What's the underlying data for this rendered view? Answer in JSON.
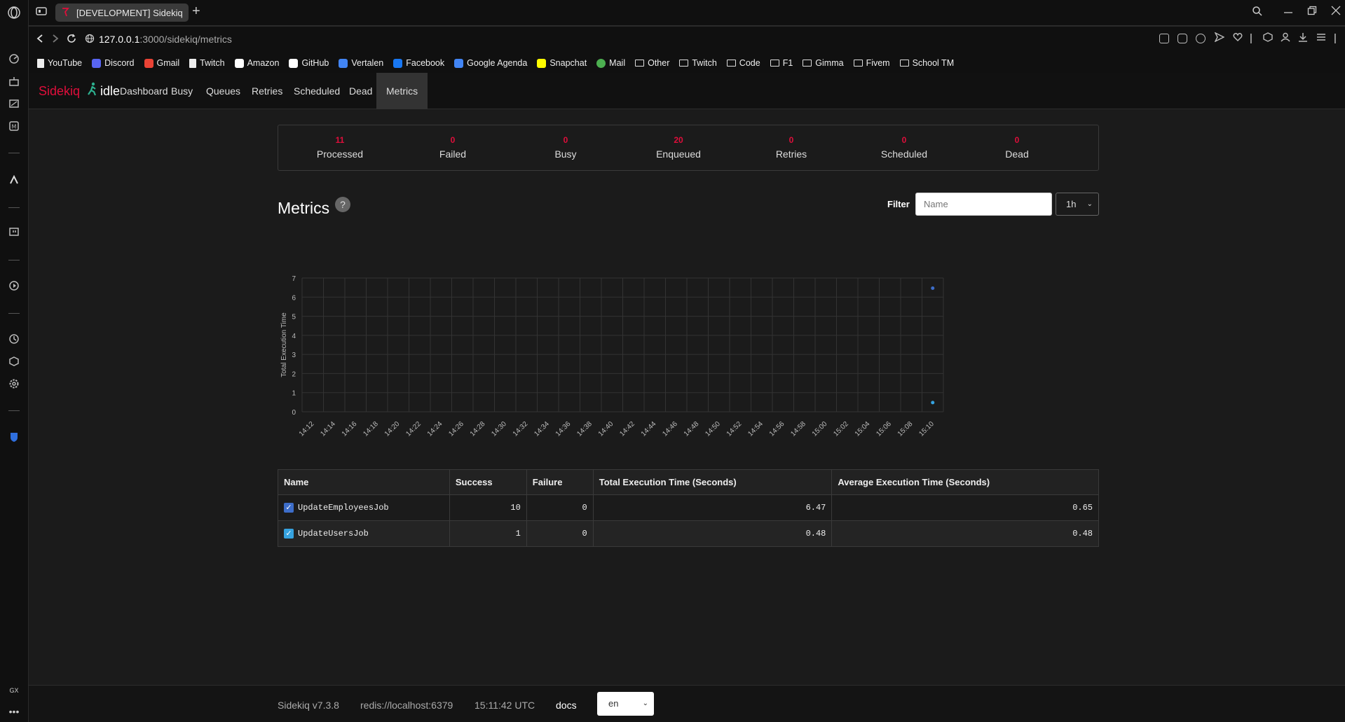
{
  "browser": {
    "tab_title": "[DEVELOPMENT] Sidekiq",
    "url_host": "127.0.0.1",
    "url_path": ":3000/sidekiq/metrics",
    "bookmarks": [
      {
        "label": "YouTube",
        "icon": "page-icon"
      },
      {
        "label": "Discord",
        "icon": "discord-icon",
        "color": "#5865f2"
      },
      {
        "label": "Gmail",
        "icon": "gmail-icon",
        "color": "#ea4335"
      },
      {
        "label": "Twitch",
        "icon": "page-icon"
      },
      {
        "label": "Amazon",
        "icon": "amazon-icon",
        "color": "#ffffff"
      },
      {
        "label": "GitHub",
        "icon": "github-icon",
        "color": "#ffffff"
      },
      {
        "label": "Vertalen",
        "icon": "translate-icon",
        "color": "#4285f4"
      },
      {
        "label": "Facebook",
        "icon": "facebook-icon",
        "color": "#1877f2"
      },
      {
        "label": "Google Agenda",
        "icon": "calendar-icon",
        "color": "#4285f4"
      },
      {
        "label": "Snapchat",
        "icon": "snapchat-icon",
        "color": "#fffc00"
      },
      {
        "label": "Mail",
        "icon": "mail-icon",
        "color": "#4caf50"
      },
      {
        "label": "Other",
        "icon": "folder-icon"
      },
      {
        "label": "Twitch",
        "icon": "folder-icon"
      },
      {
        "label": "Code",
        "icon": "folder-icon"
      },
      {
        "label": "F1",
        "icon": "folder-icon"
      },
      {
        "label": "Gimma",
        "icon": "folder-icon"
      },
      {
        "label": "Fivem",
        "icon": "folder-icon"
      },
      {
        "label": "School TM",
        "icon": "folder-icon"
      }
    ],
    "sidebar_footer": "GX"
  },
  "sidekiq": {
    "brand": "Sidekiq",
    "status": "idle",
    "nav": [
      "Dashboard",
      "Busy",
      "Queues",
      "Retries",
      "Scheduled",
      "Dead",
      "Metrics"
    ],
    "active_nav": "Metrics",
    "stats": [
      {
        "value": "11",
        "label": "Processed"
      },
      {
        "value": "0",
        "label": "Failed"
      },
      {
        "value": "0",
        "label": "Busy"
      },
      {
        "value": "20",
        "label": "Enqueued"
      },
      {
        "value": "0",
        "label": "Retries"
      },
      {
        "value": "0",
        "label": "Scheduled"
      },
      {
        "value": "0",
        "label": "Dead"
      }
    ],
    "metrics_title": "Metrics",
    "help_symbol": "?",
    "filter_label": "Filter",
    "filter_placeholder": "Name",
    "period": "1h",
    "table": {
      "headers": [
        "Name",
        "Success",
        "Failure",
        "Total Execution Time (Seconds)",
        "Average Execution Time (Seconds)"
      ],
      "rows": [
        {
          "name": "UpdateEmployeesJob",
          "success": "10",
          "failure": "0",
          "total": "6.47",
          "avg": "0.65",
          "checked": true,
          "color": "#3d6dc9"
        },
        {
          "name": "UpdateUsersJob",
          "success": "1",
          "failure": "0",
          "total": "0.48",
          "avg": "0.48",
          "checked": true,
          "color": "#36a3e0"
        }
      ]
    },
    "footer": {
      "version": "Sidekiq v7.3.8",
      "redis": "redis://localhost:6379",
      "time": "15:11:42 UTC",
      "docs": "docs",
      "lang": "en"
    }
  },
  "chart_data": {
    "type": "scatter",
    "ylabel": "Total Execution Time",
    "ylim": [
      0,
      7
    ],
    "yticks": [
      0,
      1,
      2,
      3,
      4,
      5,
      6,
      7
    ],
    "x_categories": [
      "14:12",
      "14:14",
      "14:16",
      "14:18",
      "14:20",
      "14:22",
      "14:24",
      "14:26",
      "14:28",
      "14:30",
      "14:32",
      "14:34",
      "14:36",
      "14:38",
      "14:40",
      "14:42",
      "14:44",
      "14:46",
      "14:48",
      "14:50",
      "14:52",
      "14:54",
      "14:56",
      "14:58",
      "15:00",
      "15:02",
      "15:04",
      "15:06",
      "15:08",
      "15:10"
    ],
    "series": [
      {
        "name": "UpdateEmployeesJob",
        "color": "#3d6dc9",
        "points": [
          {
            "x": "15:10",
            "y": 6.47
          }
        ]
      },
      {
        "name": "UpdateUsersJob",
        "color": "#36a3e0",
        "points": [
          {
            "x": "15:10",
            "y": 0.48
          }
        ]
      }
    ]
  }
}
